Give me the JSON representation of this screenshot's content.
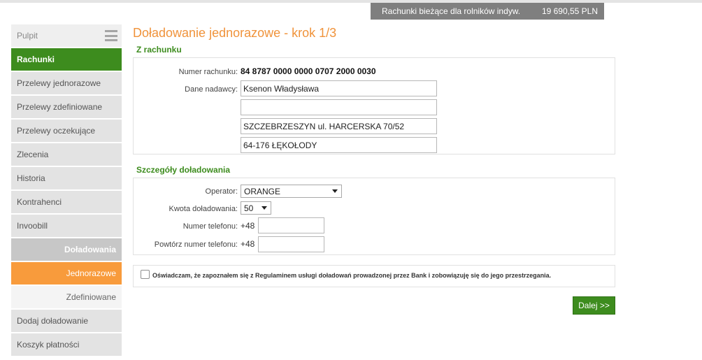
{
  "header": {
    "account_name": "Rachunki bieżące dla rolników indyw.",
    "account_balance": "19 690,55 PLN"
  },
  "sidebar": {
    "items": [
      {
        "label": "Pulpit",
        "icon": "menu-icon"
      },
      {
        "label": "Rachunki"
      },
      {
        "label": "Przelewy jednorazowe"
      },
      {
        "label": "Przelewy zdefiniowane"
      },
      {
        "label": "Przelewy oczekujące"
      },
      {
        "label": "Zlecenia"
      },
      {
        "label": "Historia"
      },
      {
        "label": "Kontrahenci"
      },
      {
        "label": "Invoobill"
      },
      {
        "label": "Doładowania"
      },
      {
        "label": "Jednorazowe"
      },
      {
        "label": "Zdefiniowane"
      },
      {
        "label": "Dodaj doładowanie"
      },
      {
        "label": "Koszyk płatności"
      }
    ]
  },
  "main": {
    "title": "Doładowanie jednorazowe - krok 1/3",
    "from_account": {
      "section_title": "Z rachunku",
      "account_number_label": "Numer rachunku:",
      "account_number_value": "84 8787 0000 0000 0707 2000 0030",
      "sender_label": "Dane nadawcy:",
      "sender_line1": "Ksenon Władysława",
      "sender_line2": "",
      "sender_line3": "SZCZEBRZESZYN ul. HARCERSKA 70/52",
      "sender_line4": "64-176 ŁĘKOŁODY"
    },
    "details": {
      "section_title": "Szczegóły doładowania",
      "operator_label": "Operator:",
      "operator_value": "ORANGE",
      "amount_label": "Kwota doładowania:",
      "amount_value": "50",
      "phone_label": "Numer telefonu:",
      "phone_prefix": "+48",
      "phone_value": "",
      "phone_repeat_label": "Powtórz numer telefonu:",
      "phone_repeat_prefix": "+48",
      "phone_repeat_value": ""
    },
    "consent": {
      "checked": false,
      "text": "Oświadczam, że zapoznałem się z Regulaminem usługi doładowań prowadzonej przez Bank i zobowiązuję się do jego przestrzegania."
    },
    "next_button": "Dalej >>"
  },
  "colors": {
    "accent_green": "#3d8c1e",
    "accent_orange": "#f89b3c",
    "title_orange": "#f0933b"
  }
}
